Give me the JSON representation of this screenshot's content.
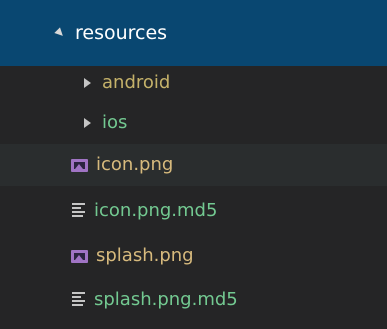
{
  "explorer": {
    "items": [
      {
        "label": "resources",
        "kind": "folder",
        "state": "expanded"
      },
      {
        "label": "android",
        "kind": "folder",
        "state": "collapsed"
      },
      {
        "label": "ios",
        "kind": "folder",
        "state": "collapsed"
      },
      {
        "label": "icon.png",
        "kind": "file",
        "icon": "image-file-icon"
      },
      {
        "label": "icon.png.md5",
        "kind": "file",
        "icon": "text-file-icon"
      },
      {
        "label": "splash.png",
        "kind": "file",
        "icon": "image-file-icon"
      },
      {
        "label": "splash.png.md5",
        "kind": "file",
        "icon": "text-file-icon"
      }
    ]
  },
  "colors": {
    "sidebar_background": "#252526",
    "selection_background": "#094771",
    "hover_background": "#2a2d2e",
    "selected_text": "#ffffff",
    "folder_text": "#c5b26a",
    "untracked_file_text": "#73c991",
    "image_file_text": "#d7ba7d",
    "image_icon": "#a074c4",
    "text_icon": "#c5c5c5"
  }
}
